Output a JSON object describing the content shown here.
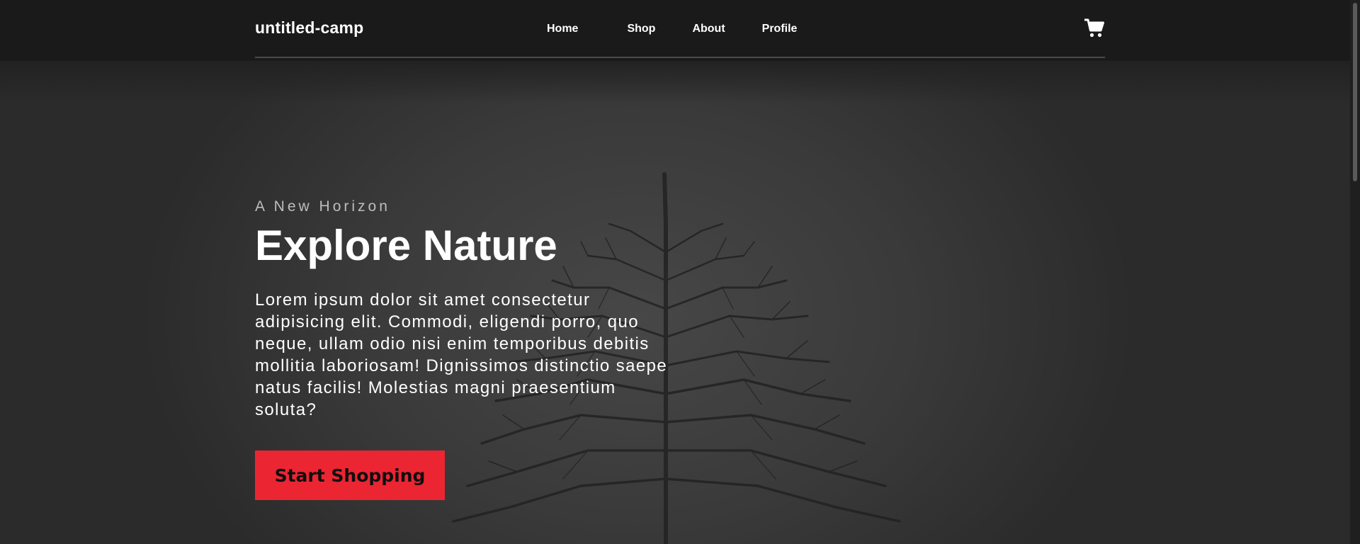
{
  "header": {
    "brand": "untitled-camp",
    "nav": [
      {
        "label": "Home"
      },
      {
        "label": "Shop"
      },
      {
        "label": "About"
      },
      {
        "label": "Profile"
      }
    ],
    "cart_icon": "shopping-cart-icon"
  },
  "hero": {
    "eyebrow": "A New Horizon",
    "title": "Explore Nature",
    "description": "Lorem ipsum dolor sit amet consectetur adipisicing elit. Commodi, eligendi porro, quo neque, ullam odio nisi enim temporibus debitis mollitia laboriosam! Dignissimos distinctio saepe natus facilis! Molestias magni praesentium soluta?",
    "cta_label": "Start Shopping"
  },
  "colors": {
    "accent": "#ec2533",
    "header_bg": "#1a1a1a",
    "text": "#ffffff"
  }
}
